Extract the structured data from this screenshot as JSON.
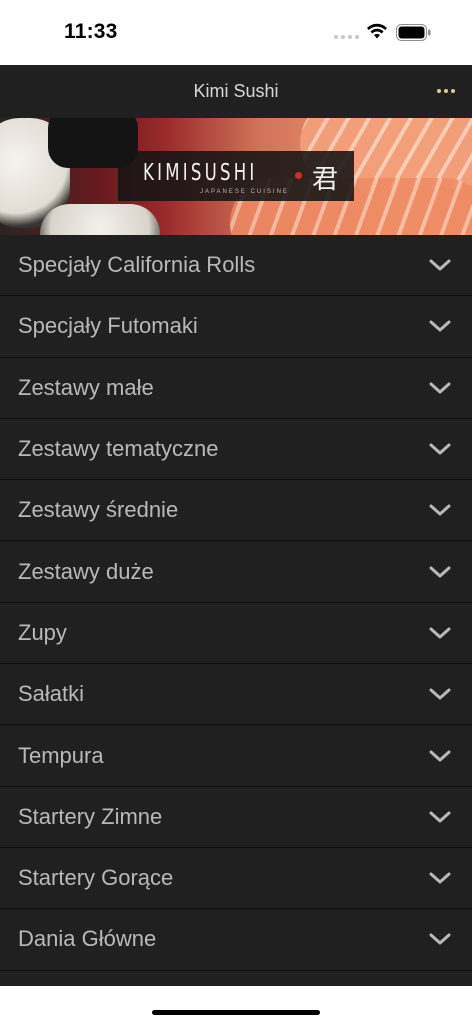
{
  "status_bar": {
    "time": "11:33"
  },
  "nav": {
    "title": "Kimi Sushi",
    "more_icon": "ellipsis-icon"
  },
  "hero": {
    "logo_text": "KIMISUSHI",
    "logo_kanji": "君",
    "logo_subtitle": "JAPANESE CUISINE"
  },
  "menu": {
    "items": [
      {
        "label": "Specjały California Rolls"
      },
      {
        "label": "Specjały Futomaki"
      },
      {
        "label": "Zestawy małe"
      },
      {
        "label": "Zestawy tematyczne"
      },
      {
        "label": "Zestawy średnie"
      },
      {
        "label": "Zestawy duże"
      },
      {
        "label": "Zupy"
      },
      {
        "label": "Sałatki"
      },
      {
        "label": "Tempura"
      },
      {
        "label": "Startery Zimne"
      },
      {
        "label": "Startery Gorące"
      },
      {
        "label": "Dania Główne"
      }
    ]
  },
  "colors": {
    "nav_bg": "#202020",
    "list_bg": "#202020",
    "text": "#b9b9b9",
    "accent": "#e6c98a"
  }
}
